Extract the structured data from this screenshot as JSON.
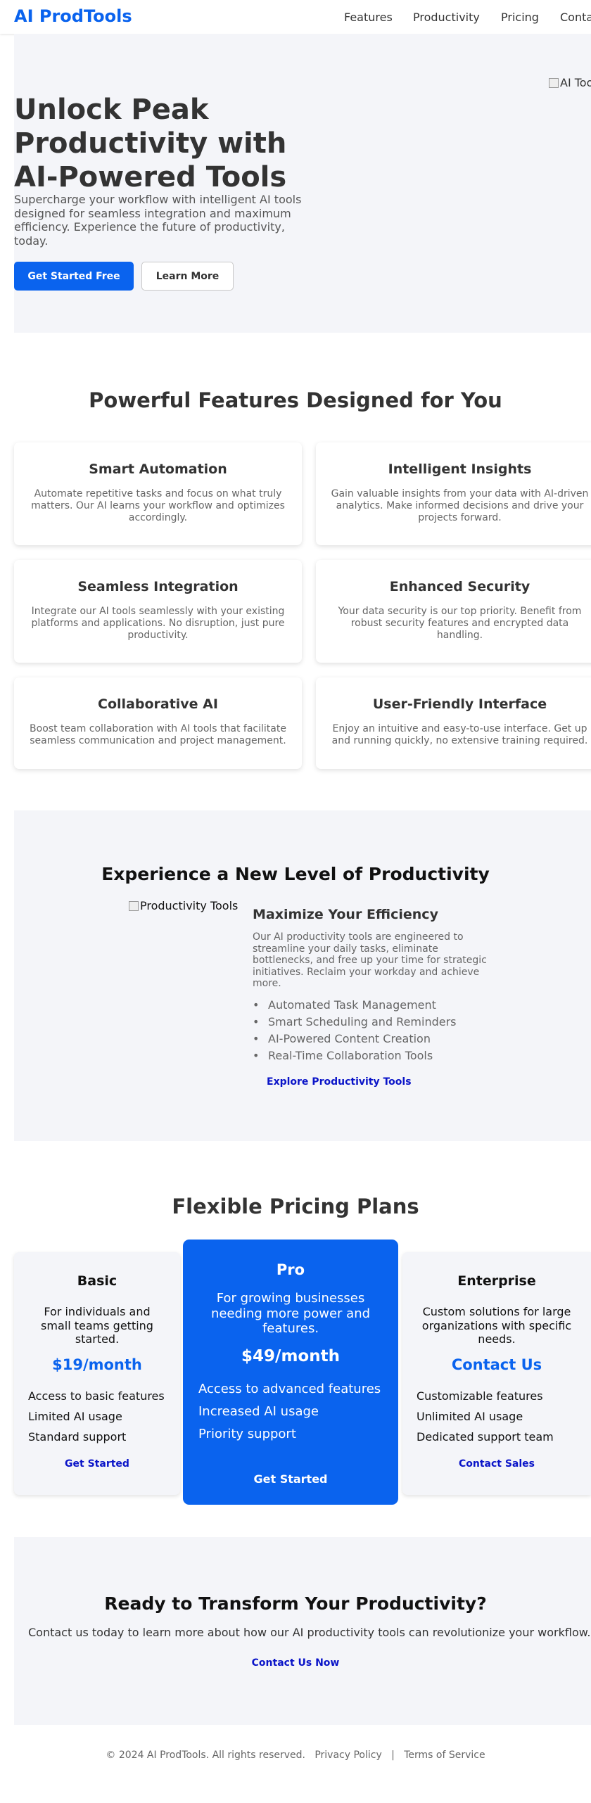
{
  "header": {
    "logo": "AI ProdTools",
    "nav": [
      "Features",
      "Productivity",
      "Pricing",
      "Contact"
    ]
  },
  "hero": {
    "title": "Unlock Peak Productivity with AI-Powered Tools",
    "text": "Supercharge your workflow with intelligent AI tools designed for seamless integration and maximum efficiency. Experience the future of productivity, today.",
    "primary_button": "Get Started Free",
    "secondary_button": "Learn More",
    "image_alt": "AI Tools"
  },
  "features": {
    "title": "Powerful Features Designed for You",
    "cards": [
      {
        "title": "Smart Automation",
        "text": "Automate repetitive tasks and focus on what truly matters. Our AI learns your workflow and optimizes accordingly."
      },
      {
        "title": "Intelligent Insights",
        "text": "Gain valuable insights from your data with AI-driven analytics. Make informed decisions and drive your projects forward."
      },
      {
        "title": "Seamless Integration",
        "text": "Integrate our AI tools seamlessly with your existing platforms and applications. No disruption, just pure productivity."
      },
      {
        "title": "Enhanced Security",
        "text": "Your data security is our top priority. Benefit from robust security features and encrypted data handling."
      },
      {
        "title": "Collaborative AI",
        "text": "Boost team collaboration with AI tools that facilitate seamless communication and project management."
      },
      {
        "title": "User-Friendly Interface",
        "text": "Enjoy an intuitive and easy-to-use interface. Get up and running quickly, no extensive training required."
      }
    ]
  },
  "productivity": {
    "title": "Experience a New Level of Productivity",
    "image_alt": "Productivity Tools",
    "subtitle": "Maximize Your Efficiency",
    "text": "Our AI productivity tools are engineered to streamline your daily tasks, eliminate bottlenecks, and free up your time for strategic initiatives. Reclaim your workday and achieve more.",
    "list": [
      "Automated Task Management",
      "Smart Scheduling and Reminders",
      "AI-Powered Content Creation",
      "Real-Time Collaboration Tools"
    ],
    "link": "Explore Productivity Tools"
  },
  "pricing": {
    "title": "Flexible Pricing Plans",
    "basic": {
      "name": "Basic",
      "desc": "For individuals and small teams getting started.",
      "price": "$19/month",
      "features": [
        "Access to basic features",
        "Limited AI usage",
        "Standard support"
      ],
      "cta": "Get Started"
    },
    "pro": {
      "name": "Pro",
      "desc": "For growing businesses needing more power and features.",
      "price": "$49/month",
      "features": [
        "Access to advanced features",
        "Increased AI usage",
        "Priority support"
      ],
      "cta": "Get Started"
    },
    "enterprise": {
      "name": "Enterprise",
      "desc": "Custom solutions for large organizations with specific needs.",
      "price": "Contact Us",
      "features": [
        "Customizable features",
        "Unlimited AI usage",
        "Dedicated support team"
      ],
      "cta": "Contact Sales"
    }
  },
  "cta": {
    "title": "Ready to Transform Your Productivity?",
    "text": "Contact us today to learn more about how our AI productivity tools can revolutionize your workflow.",
    "link": "Contact Us Now"
  },
  "footer": {
    "copyright": "© 2024 AI ProdTools. All rights reserved.",
    "privacy": "Privacy Policy",
    "separator": "|",
    "terms": "Terms of Service"
  },
  "colors": {
    "brand": "#0a63ee",
    "link": "#0a14c8",
    "section_bg": "#f4f5f9"
  }
}
